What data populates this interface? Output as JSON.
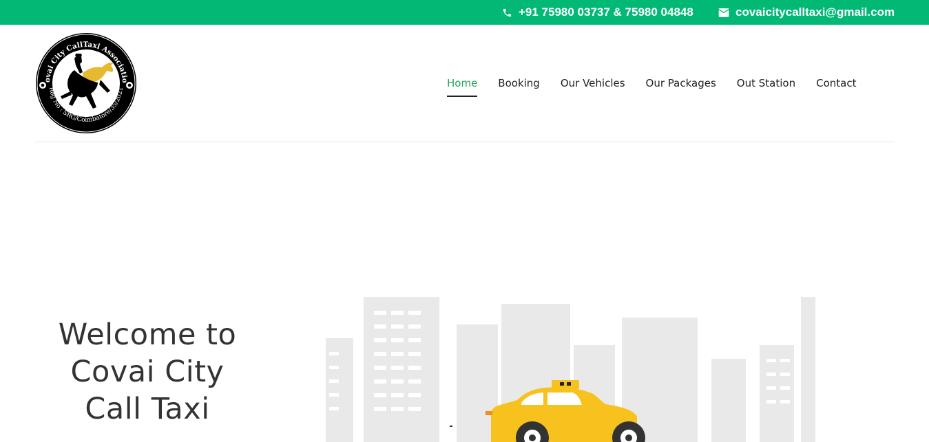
{
  "topbar": {
    "phone": "+91 75980 03737 & 75980 04848",
    "email": "covaicitycalltaxi@gmail.com",
    "phone_icon": "phone-icon",
    "email_icon": "envelope-icon",
    "background_color": "#01b875"
  },
  "logo": {
    "text_top": "Covai City CallTaxi Association",
    "text_bottom": "Reg No : SRG/Coimbatore/35/2021"
  },
  "nav": {
    "items": [
      {
        "label": "Home",
        "active": true
      },
      {
        "label": "Booking"
      },
      {
        "label": "Our Vehicles"
      },
      {
        "label": "Our Packages"
      },
      {
        "label": "Out Station"
      },
      {
        "label": "Contact"
      }
    ],
    "active_color": "#23a455"
  },
  "hero": {
    "title_line1": "Welcome to",
    "title_line2": "Covai City",
    "title_line3": "Call Taxi",
    "taxi_color": "#f7c21d"
  }
}
